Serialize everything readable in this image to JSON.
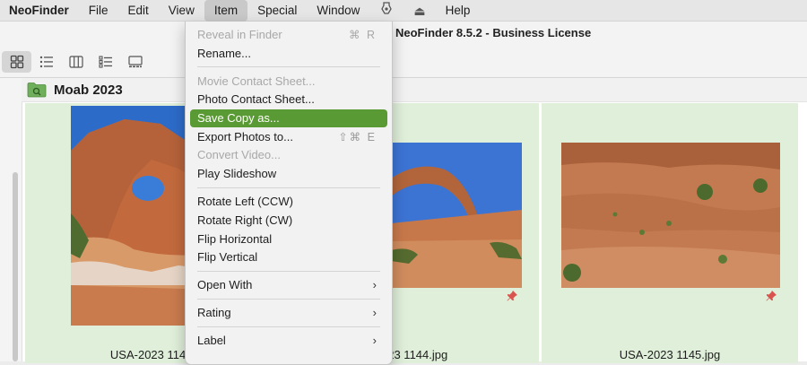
{
  "menubar": {
    "items": [
      {
        "label": "NeoFinder",
        "app": true
      },
      {
        "label": "File"
      },
      {
        "label": "Edit"
      },
      {
        "label": "View"
      },
      {
        "label": "Item",
        "active": true
      },
      {
        "label": "Special"
      },
      {
        "label": "Window"
      },
      {
        "label": "⏏"
      },
      {
        "label": "Help"
      }
    ],
    "icon_name": "script-icon"
  },
  "window": {
    "title": "NeoFinder 8.5.2 - Business License"
  },
  "folder": {
    "title": "Moab 2023",
    "color": "#6fae5a"
  },
  "photos": [
    {
      "name": "USA-2023 1143.jpg",
      "visible_text": "USA-2023 1143.",
      "pinned": false
    },
    {
      "name": "USA-2023 1144.jpg",
      "visible_text": "2023 1144.jpg",
      "pinned": true
    },
    {
      "name": "USA-2023 1145.jpg",
      "visible_text": "USA-2023 1145.jpg",
      "pinned": true
    }
  ],
  "item_menu": {
    "highlight_color": "#5a9a35",
    "entries": [
      {
        "label": "Reveal in Finder",
        "shortcut": "⌘ R",
        "disabled": true
      },
      {
        "label": "Rename..."
      },
      {
        "label": "Movie Contact Sheet...",
        "disabled": true
      },
      {
        "label": "Photo Contact Sheet..."
      },
      {
        "label": "Save Copy as...",
        "highlighted": true
      },
      {
        "label": "Export Photos to...",
        "shortcut": "⇧⌘ E"
      },
      {
        "label": "Convert Video...",
        "disabled": true
      },
      {
        "label": "Play Slideshow"
      },
      {
        "label": "Rotate Left (CCW)"
      },
      {
        "label": "Rotate Right (CW)"
      },
      {
        "label": "Flip Horizontal"
      },
      {
        "label": "Flip Vertical"
      },
      {
        "label": "Open With",
        "submenu": true
      },
      {
        "label": "Rating",
        "submenu": true
      },
      {
        "label": "Label",
        "submenu": true
      }
    ]
  },
  "pin_color": "#d9534f"
}
